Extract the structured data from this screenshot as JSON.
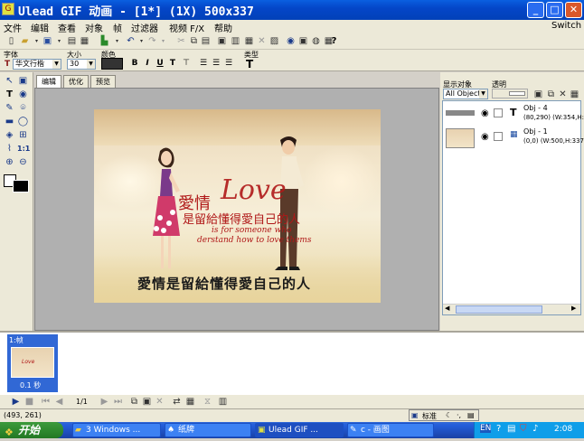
{
  "window": {
    "title": "Ulead GIF 动画 - [1*] (1X) 500x337",
    "buttons": [
      "_",
      "□",
      "✕"
    ]
  },
  "menu": {
    "items": [
      "文件",
      "编辑",
      "查看",
      "对象",
      "帧",
      "过滤器",
      "视频 F/X",
      "帮助"
    ],
    "switch_label": "Switch"
  },
  "format_bar": {
    "font_label": "字体",
    "font_value": "华文行楷",
    "size_label": "大小",
    "size_value": "30",
    "color_label": "颜色",
    "type_label": "类型",
    "style_buttons": [
      "B",
      "I",
      "U",
      "T"
    ]
  },
  "tabs": [
    "编辑",
    "优化",
    "预览"
  ],
  "canvas": {
    "big_text_1": "愛情",
    "big_text_love": "Love",
    "big_text_2": "是留給懂得愛自己的人",
    "english_line_1": "is for someone who",
    "english_line_2": "derstand how to love thems",
    "bottom_caption": "愛情是留給懂得愛自己的人"
  },
  "right_panel": {
    "show_objects_label": "显示对象",
    "show_objects_value": "All Object",
    "opacity_label": "透明",
    "objects": [
      {
        "name": "Obj - 4",
        "info": "(80,290) (W:354,H:",
        "type_icon": "T"
      },
      {
        "name": "Obj - 1",
        "info": "(0,0) (W:500,H:337",
        "type_icon": "▦"
      }
    ]
  },
  "frames": {
    "frame_label": "1:帧",
    "frame_delay": "0.1 秒",
    "counter": "1/1"
  },
  "status": {
    "coords": "(493, 261)",
    "ime_label": "标准"
  },
  "taskbar": {
    "start_label": "开始",
    "items": [
      {
        "label": "3 Windows ...",
        "active": false
      },
      {
        "label": "纸牌",
        "active": false
      },
      {
        "label": "Ulead GIF ...",
        "active": true
      },
      {
        "label": "c - 画图",
        "active": false
      }
    ],
    "clock": "2:08"
  }
}
